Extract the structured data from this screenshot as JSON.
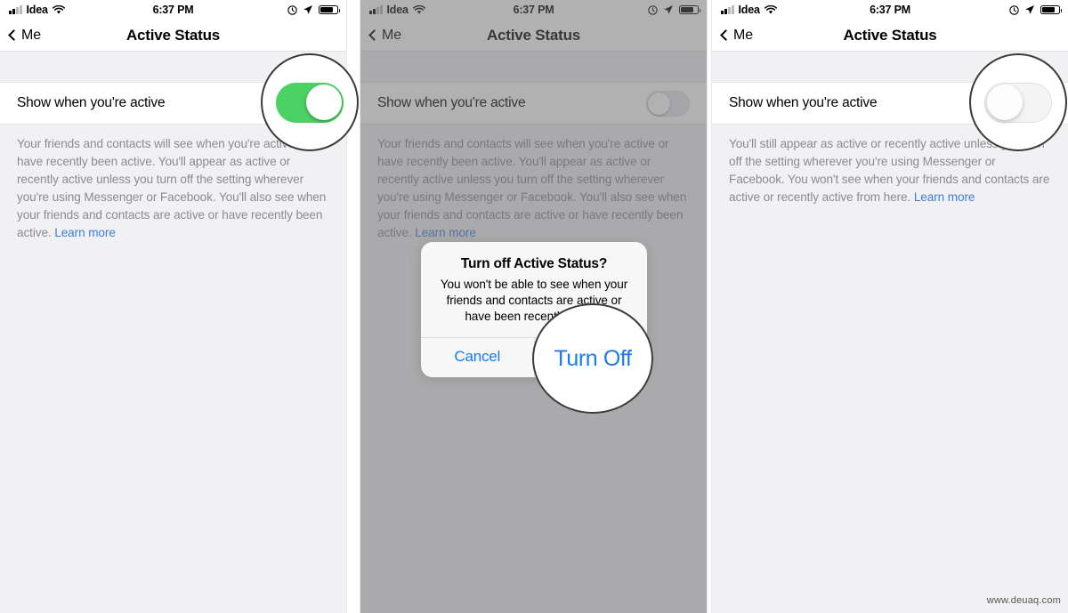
{
  "meta": {
    "watermark": "www.deuaq.com"
  },
  "status_bar": {
    "carrier": "Idea",
    "time": "6:37 PM",
    "icons": [
      "signal-icon",
      "wifi-icon",
      "alarm-icon",
      "location-arrow-icon",
      "battery-icon"
    ]
  },
  "nav": {
    "back_label": "Me",
    "title": "Active Status"
  },
  "setting": {
    "row_label": "Show when you're active"
  },
  "panels": [
    {
      "id": "panel-1",
      "toggle_state": "on",
      "dimmed": false,
      "description": "Your friends and contacts will see when you're active or have recently been active. You'll appear as active or recently active unless you turn off the setting wherever you're using Messenger or Facebook. You'll also see when your friends and contacts are active or have recently been active. ",
      "link_label": "Learn more"
    },
    {
      "id": "panel-2",
      "toggle_state": "off",
      "dimmed": true,
      "description": "Your friends and contacts will see when you're active or have recently been active. You'll appear as active or recently active unless you turn off the setting wherever you're using Messenger or Facebook. You'll also see when your friends and contacts are active or have recently been active. ",
      "link_label": "Learn more"
    },
    {
      "id": "panel-3",
      "toggle_state": "off",
      "dimmed": false,
      "description": "You'll still appear as active or recently active unless you turn off the setting wherever you're using Messenger or Facebook. You won't see when your friends and contacts are active or recently active from here. ",
      "link_label": "Learn more"
    }
  ],
  "dialog": {
    "title": "Turn off Active Status?",
    "message": "You won't be able to see when your friends and contacts are active or have been recently active.",
    "cancel_label": "Cancel",
    "confirm_label": "Turn Off"
  },
  "colors": {
    "toggle_on": "#4cd264",
    "link_blue": "#3b7ddd",
    "action_blue": "#1a7bf0",
    "background_gray": "#f1f1f3",
    "dim_overlay": "#8b8b8e",
    "ring_stroke": "#3a3a3a"
  }
}
